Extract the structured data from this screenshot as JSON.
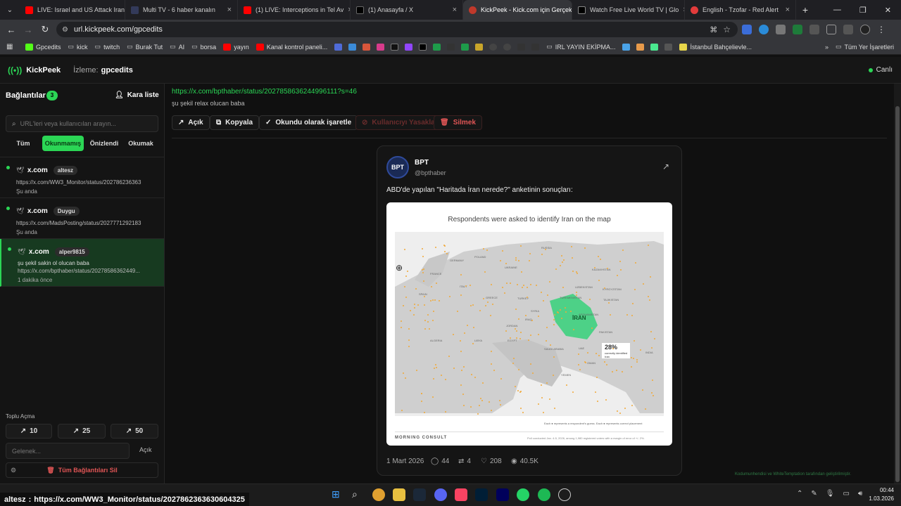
{
  "browser": {
    "tabs": [
      {
        "label": "LIVE: Israel and US Attack Iran",
        "color": "#ff0000"
      },
      {
        "label": "Multi TV - 6 haber kanalın",
        "color": "#333a5a"
      },
      {
        "label": "(1) LIVE: Interceptions in Tel Av",
        "color": "#ff0000"
      },
      {
        "label": "(1) Anasayfa / X",
        "color": "#000000"
      },
      {
        "label": "KickPeek - Kick.com için Gerçek",
        "color": "#c0392b"
      },
      {
        "label": "Watch Free Live World TV | Glo",
        "color": "#000000"
      },
      {
        "label": "English - Tzofar - Red Alert",
        "color": "#e23b3b"
      }
    ],
    "url": "url.kickpeek.com/gpcedits",
    "bookmarks": [
      "Gpcedits",
      "kick",
      "twitch",
      "Burak Tut",
      "AI",
      "borsa",
      "yayın",
      "Kanal kontrol paneli..."
    ],
    "bookmarks_right": [
      "IRL YAYIN EKİPMA...",
      "İstanbul Bahçelievle..."
    ],
    "all_bookmarks": "Tüm Yer İşaretleri"
  },
  "app": {
    "brand": "KickPeek",
    "watching_label": "İzleme:",
    "watching_user": "gpcedits",
    "status": "Canlı"
  },
  "sidebar": {
    "title": "Bağlantılar",
    "count": "3",
    "blacklist": "Kara liste",
    "search_placeholder": "URL'leri veya kullanıcıları arayın...",
    "filters": [
      "Tüm",
      "Okunmamış",
      "Önizlendi",
      "Okumak"
    ],
    "connections": [
      {
        "host": "x.com",
        "user": "altesz",
        "url": "https://x.com/WW3_Monitor/status/202786236363",
        "text": "",
        "when": "Şu anda"
      },
      {
        "host": "x.com",
        "user": "Duygu",
        "url": "https://x.com/MadsPosting/status/2027771292183",
        "text": "",
        "when": "Şu anda"
      },
      {
        "host": "x.com",
        "user": "alper9815",
        "url": "https://x.com/bpthaber/status/20278586362449...",
        "text": "şu şekil sakin ol olucan baba",
        "when": "1 dakika önce"
      }
    ],
    "bulk_title": "Toplu Açma",
    "bulk": [
      "10",
      "25",
      "50"
    ],
    "custom_placeholder": "Gelenek...",
    "custom_open": "Açık",
    "delete_all": "Tüm Bağlantıları Sil"
  },
  "main": {
    "link": "https://x.com/bpthaber/status/2027858636244996111?s=46",
    "message": "şu şekil relax olucan baba",
    "actions": {
      "open": "Açık",
      "copy": "Kopyala",
      "mark_read": "Okundu olarak işaretle",
      "ban": "Kullanıcıyı Yasakla",
      "delete": "Silmek"
    },
    "tweet": {
      "name": "BPT",
      "handle": "@bpthaber",
      "avatar": "BPT",
      "text": "ABD'de yapılan \"Haritada İran nerede?\" anketinin sonuçları:",
      "image_title": "Respondents were asked to identify Iran on the map",
      "iran_label": "İRAN",
      "stat_value": "28%",
      "stat_text": "correctly identified Iran",
      "image_footer_brand": "MORNING CONSULT",
      "image_footer_note": "Poll conducted Jan. 4-5, 2026, among 1,980 registered voters with a margin of error of +/- 2%.",
      "legend": "Each ● represents a respondent's guess. Each ● represents correct placement",
      "date": "1 Mart 2026",
      "replies": "44",
      "retweets": "4",
      "likes": "208",
      "views": "40.5K"
    },
    "map_countries": [
      "RUSSIA",
      "POLAND",
      "GERMANY",
      "UKRAINE",
      "FRANCE",
      "ITALY",
      "SPAIN",
      "GREECE",
      "TURKEY",
      "SYRIA",
      "IRAQ",
      "JORDAN",
      "KAZAKHSTAN",
      "UZBEKISTAN",
      "TURKMENISTAN",
      "KYRGYZSTAN",
      "TAJIKISTAN",
      "AFGHANISTAN",
      "PAKISTAN",
      "INDIA",
      "SAUDI ARABIA",
      "UAE",
      "OMAN",
      "YEMEN",
      "EGYPT",
      "LIBYA",
      "ALGERIA"
    ],
    "footer_credit": "Kodumunhendisi ve WhiteTemptation tarafından geliştirilmiştir."
  },
  "statusbar": {
    "user": "altesz",
    "url": "https://x.com/WW3_Monitor/status/2027862363630604325"
  },
  "taskbar": {
    "time": "00:44",
    "date": "1.03.2026"
  }
}
